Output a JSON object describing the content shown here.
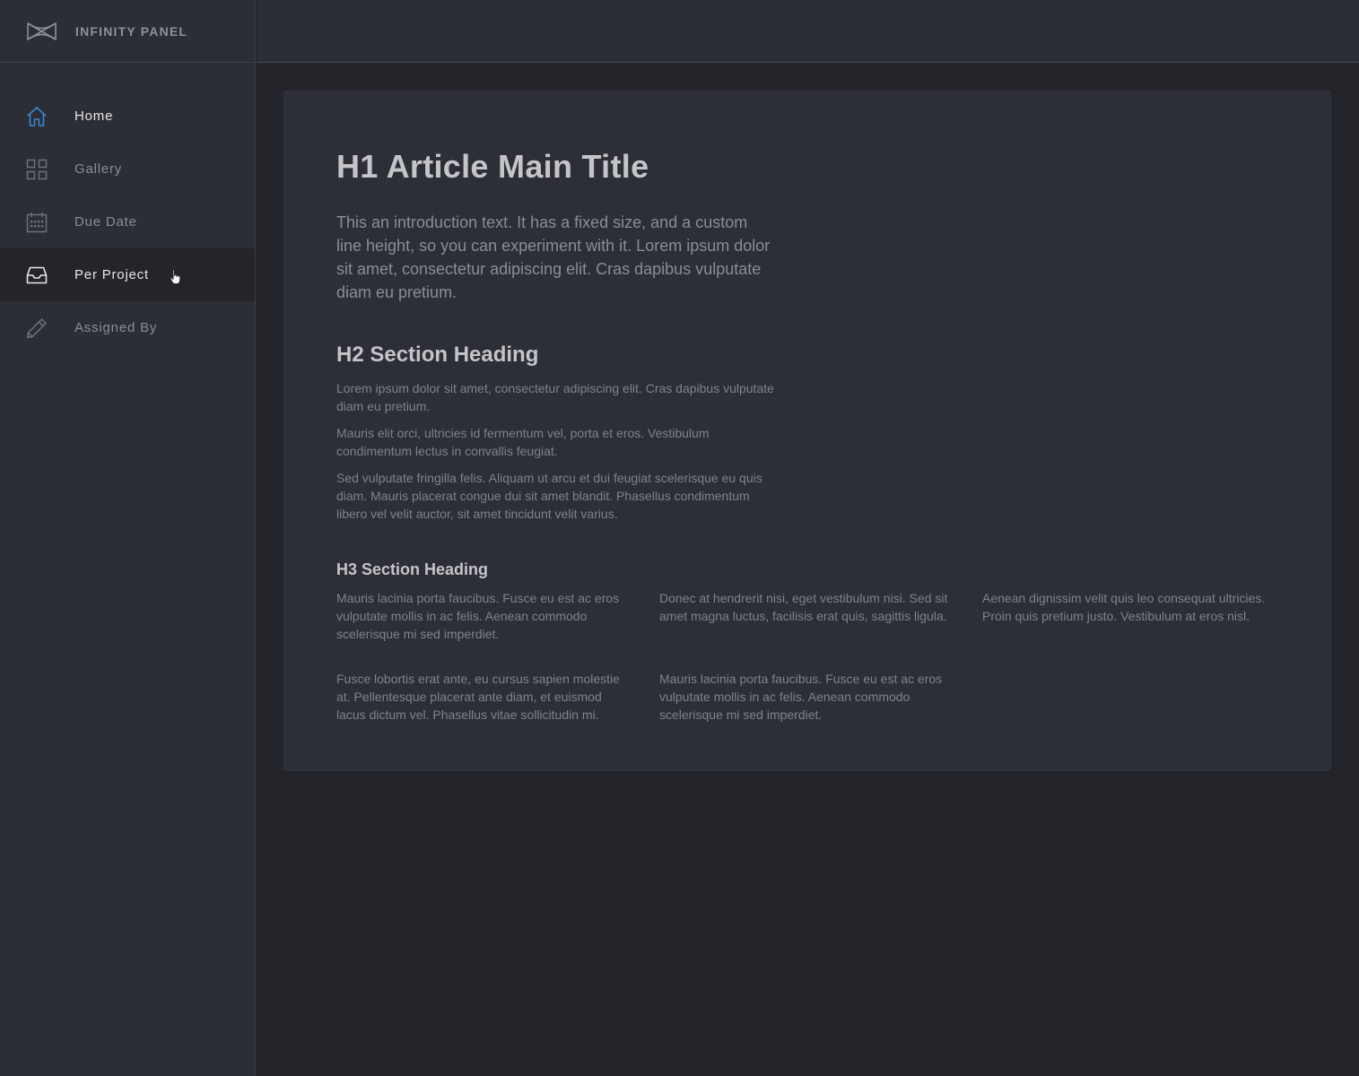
{
  "brand": {
    "name": "INFINITY PANEL",
    "icon": "infinity-bowtie-icon"
  },
  "colors": {
    "accent": "#3a87d6",
    "sidebar_bg": "#2b2e34",
    "active_bg": "#23252a",
    "page_bg": "#222429",
    "card_bg": "#2c2f35"
  },
  "nav": {
    "items": [
      {
        "label": "Home",
        "icon": "home-icon"
      },
      {
        "label": "Gallery",
        "icon": "grid-icon"
      },
      {
        "label": "Due Date",
        "icon": "calendar-icon"
      },
      {
        "label": "Per Project",
        "icon": "inbox-icon"
      },
      {
        "label": "Assigned By",
        "icon": "pencil-icon"
      }
    ]
  },
  "article": {
    "h1": "H1 Article Main Title",
    "intro": "This an introduction text. It has a fixed size, and a custom line height, so you can experiment with it. Lorem ipsum dolor sit amet, consectetur adipiscing elit. Cras dapibus vulputate diam eu pretium.",
    "h2": "H2 Section Heading",
    "paragraphs": [
      "Lorem ipsum dolor sit amet, consectetur adipiscing elit. Cras dapibus vulputate diam eu pretium.",
      "Mauris elit orci, ultricies id fermentum vel, porta et eros. Vestibulum condimentum lectus in convallis feugiat.",
      "Sed vulputate fringilla felis. Aliquam ut arcu et dui feugiat scelerisque eu quis diam. Mauris placerat congue dui sit amet blandit. Phasellus condimentum libero vel velit auctor, sit amet tincidunt velit varius."
    ],
    "h3": "H3 Section Heading",
    "columns": [
      "Mauris lacinia porta faucibus. Fusce eu est ac eros vulputate mollis in ac felis. Aenean commodo scelerisque mi sed imperdiet.",
      "Donec at hendrerit nisi, eget vestibulum nisi. Sed sit amet magna luctus, facilisis erat quis, sagittis ligula.",
      "Aenean dignissim velit quis leo consequat ultricies. Proin quis pretium justo. Vestibulum at eros nisl.",
      "Fusce lobortis erat ante, eu cursus sapien molestie at. Pellentesque placerat ante diam, et euismod lacus dictum vel. Phasellus vitae sollicitudin mi.",
      "Mauris lacinia porta faucibus. Fusce eu est ac eros vulputate mollis in ac felis. Aenean commodo scelerisque mi sed imperdiet."
    ]
  }
}
